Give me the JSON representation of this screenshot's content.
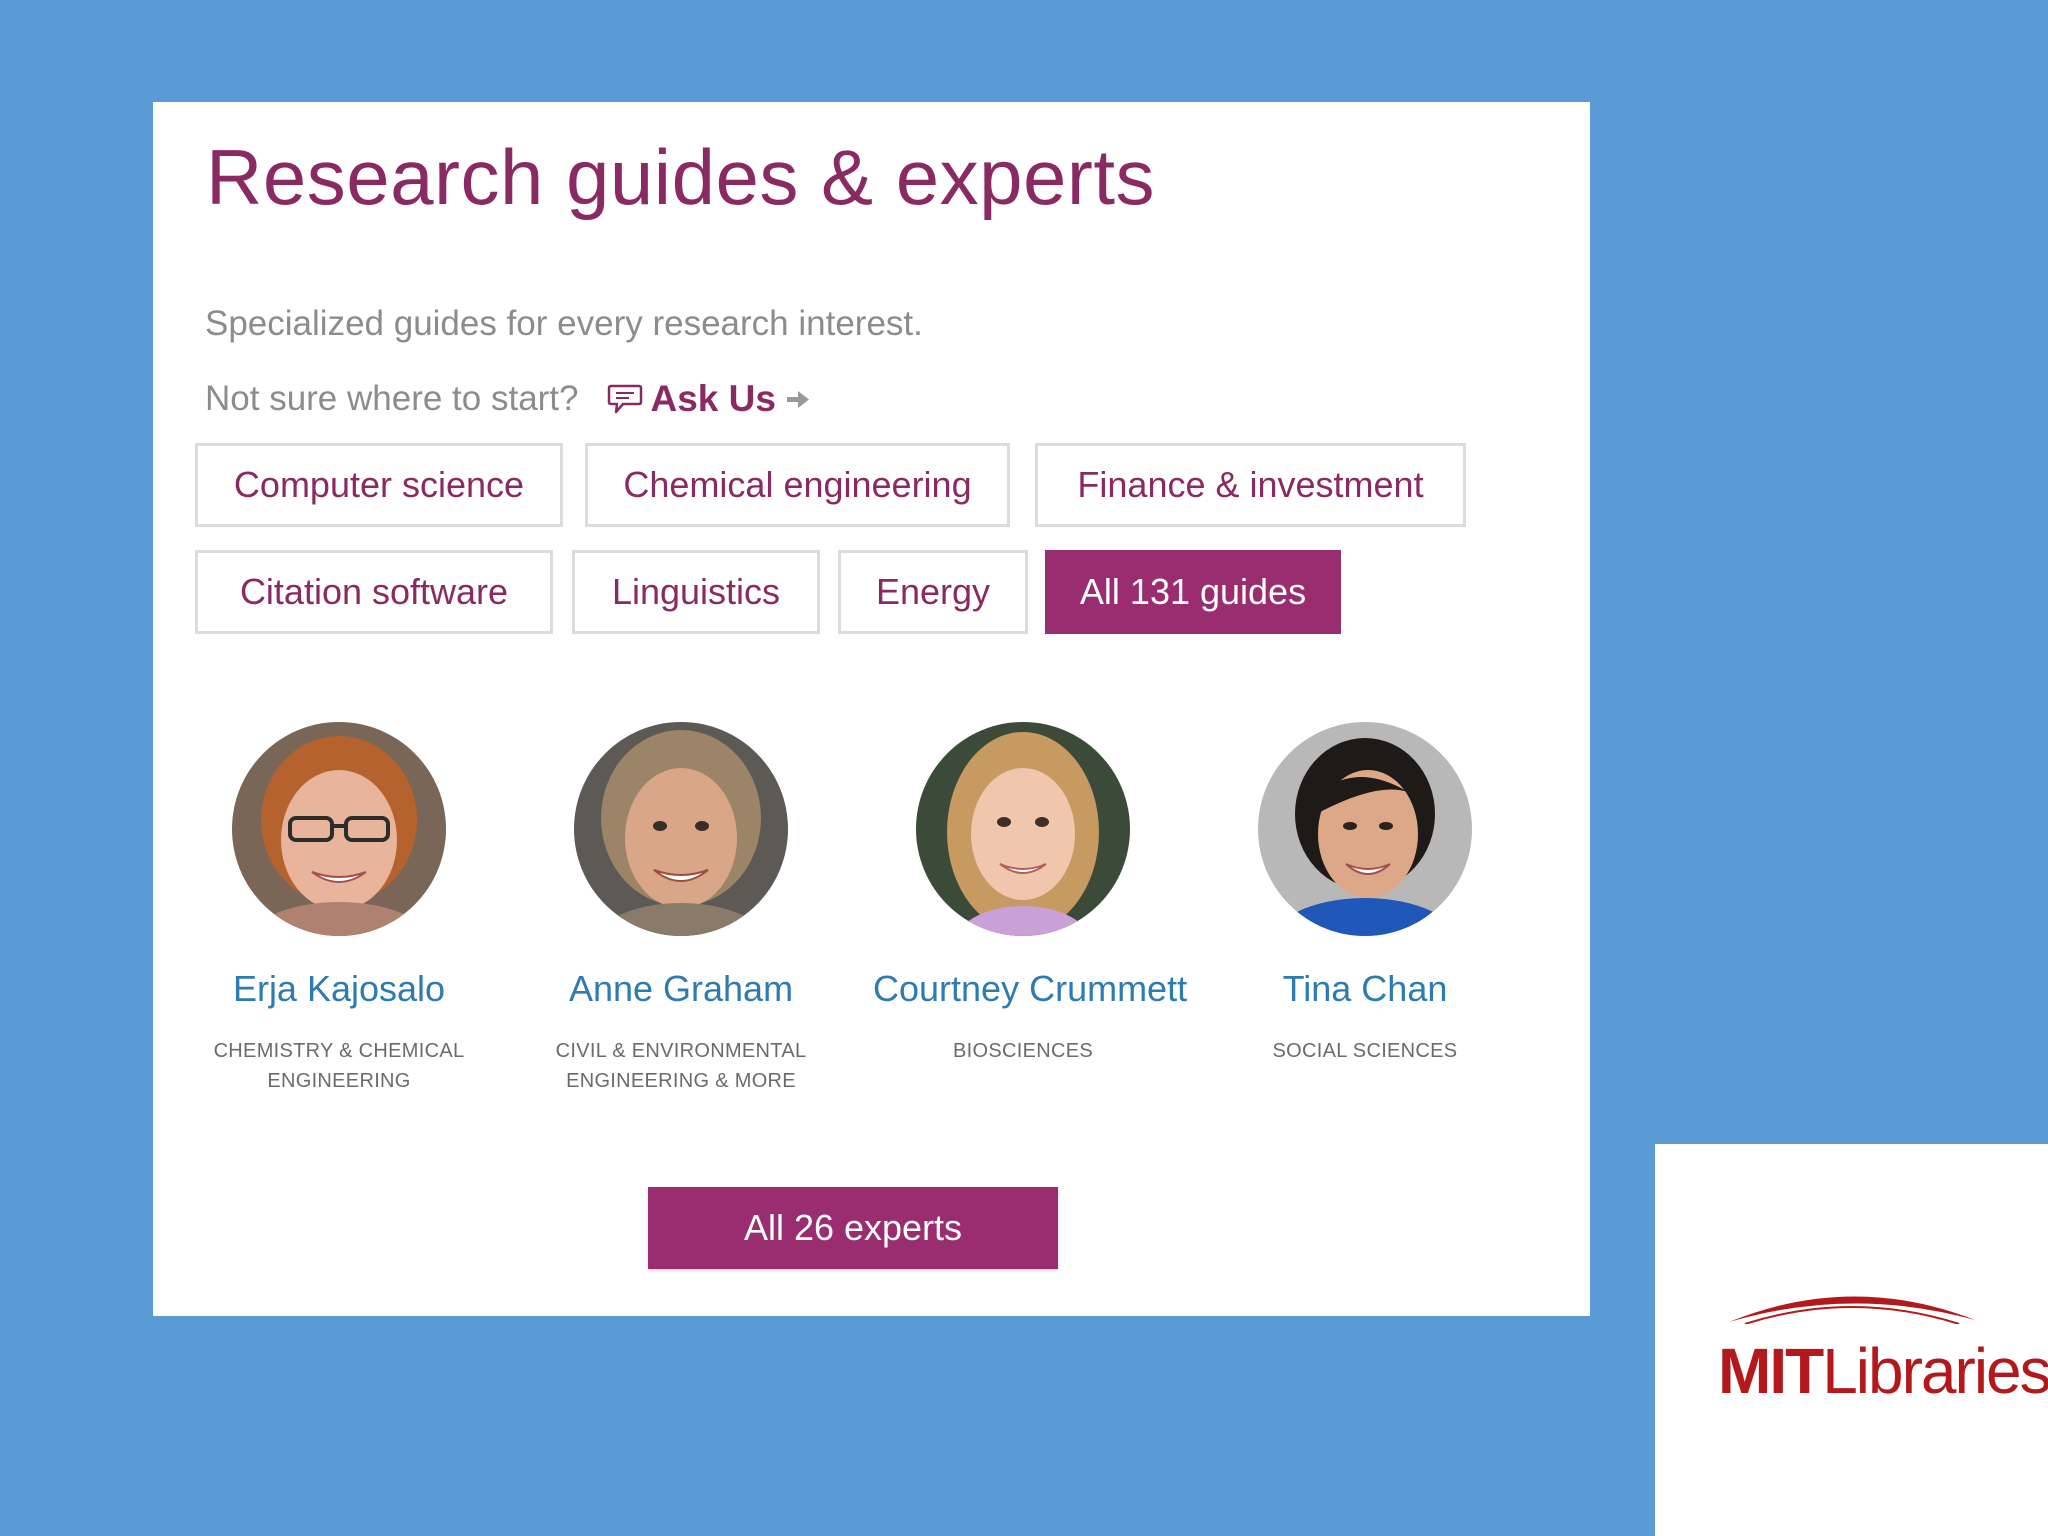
{
  "panel": {
    "title": "Research guides & experts",
    "subtitle": "Specialized guides for every research interest.",
    "ask": {
      "prompt": "Not sure where to start?",
      "link_label": "Ask Us",
      "icons": {
        "chat": "speech-bubble-icon",
        "arrow": "arrow-right-icon"
      }
    },
    "guides": [
      {
        "label": "Computer science"
      },
      {
        "label": "Chemical engineering"
      },
      {
        "label": "Finance & investment"
      },
      {
        "label": "Citation software"
      },
      {
        "label": "Linguistics"
      },
      {
        "label": "Energy"
      },
      {
        "label": "All 131 guides",
        "primary": true
      }
    ],
    "experts": [
      {
        "name": "Erja Kajosalo",
        "dept_lines": [
          "CHEMISTRY & CHEMICAL",
          "ENGINEERING"
        ]
      },
      {
        "name": "Anne Graham",
        "dept_lines": [
          "CIVIL & ENVIRONMENTAL",
          "ENGINEERING & MORE"
        ]
      },
      {
        "name": "Courtney Crummett",
        "dept_lines": [
          "BIOSCIENCES"
        ]
      },
      {
        "name": "Tina Chan",
        "dept_lines": [
          "SOCIAL SCIENCES"
        ]
      }
    ],
    "experts_button": "All 26 experts"
  },
  "logo": {
    "part1": "MIT",
    "part2": "Libraries"
  },
  "colors": {
    "background": "#5b9bd5",
    "accent": "#9a2c70",
    "title": "#8a2a63",
    "name_link": "#2d7bb0",
    "logo_red": "#b3191c"
  }
}
